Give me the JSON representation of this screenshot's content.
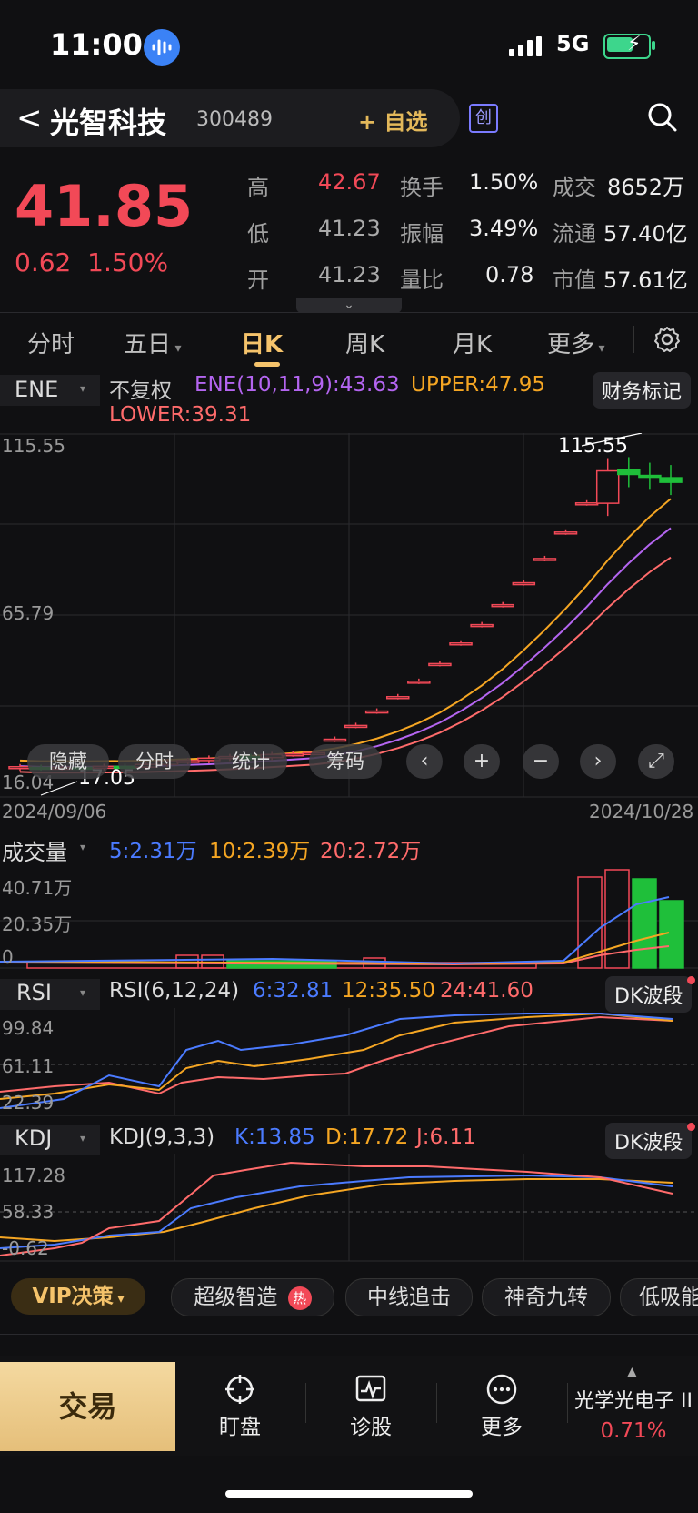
{
  "status": {
    "time": "11:00",
    "network": "5G"
  },
  "header": {
    "back": "<",
    "name": "光智科技",
    "code": "300489",
    "add_fav": "+ 自选",
    "board_badge": "创"
  },
  "quote": {
    "price": "41.85",
    "change": "0.62",
    "change_pct": "1.50%",
    "rows": [
      {
        "l1": "高",
        "v1": "42.67",
        "l2": "换手",
        "v2": "1.50%",
        "l3": "成交",
        "v3": "8652万"
      },
      {
        "l1": "低",
        "v1": "41.23",
        "l2": "振幅",
        "v2": "3.49%",
        "l3": "流通",
        "v3": "57.40亿"
      },
      {
        "l1": "开",
        "v1": "41.23",
        "l2": "量比",
        "v2": "0.78",
        "l3": "市值",
        "v3": "57.61亿"
      }
    ]
  },
  "tabs": [
    "分时",
    "五日",
    "日K",
    "周K",
    "月K",
    "更多"
  ],
  "active_tab": "日K",
  "main_chart": {
    "indicator": "ENE",
    "adjust": "不复权",
    "ene_label": "ENE(10,11,9):43.63",
    "upper_label": "UPPER:47.95",
    "lower_label": "LOWER:39.31",
    "finance_btn": "财务标记",
    "y_top": "115.55",
    "y_mid": "65.79",
    "y_bottom": "16.04",
    "max_marker": "115.55",
    "min_marker": "17.05",
    "date_start": "2024/09/06",
    "date_end": "2024/10/28",
    "overlay": {
      "hide": "隐藏",
      "intraday": "分时",
      "stats": "统计",
      "chips": "筹码"
    }
  },
  "volume": {
    "label": "成交量",
    "ma5": "5:2.31万",
    "ma10": "10:2.39万",
    "ma20": "20:2.72万",
    "y_top": "40.71万",
    "y_mid": "20.35万",
    "y_bottom": "0"
  },
  "rsi": {
    "label": "RSI",
    "params": "RSI(6,12,24)",
    "r6": "6:32.81",
    "r12": "12:35.50",
    "r24": "24:41.60",
    "btn": "DK波段",
    "y_top": "99.84",
    "y_mid": "61.11",
    "y_bottom": "22.39"
  },
  "kdj": {
    "label": "KDJ",
    "params": "KDJ(9,3,3)",
    "k": "K:13.85",
    "d": "D:17.72",
    "j": "J:6.11",
    "btn": "DK波段",
    "y_top": "117.28",
    "y_mid": "58.33",
    "y_bottom": "-0.62"
  },
  "vip": {
    "label": "VIP决策",
    "chips": [
      "超级智造",
      "中线追击",
      "神奇九转",
      "低吸能"
    ],
    "hot": "热"
  },
  "bottom_nav": {
    "trade": "交易",
    "watch": "盯盘",
    "diagnose": "诊股",
    "more": "更多",
    "sector": "光学光电子 II",
    "sector_pct": "0.71%"
  },
  "colors": {
    "up": "#f24957",
    "down": "#1fbf3a",
    "accent": "#f5c36b"
  },
  "chart_data": {
    "type": "candlestick",
    "x_range": [
      "2024/09/06",
      "2024/10/28"
    ],
    "ylim": [
      16.04,
      115.55
    ],
    "candles": [
      {
        "o": 17.05,
        "c": 17.5
      },
      {
        "o": 17.3,
        "c": 17.1
      },
      {
        "o": 17.2,
        "c": 17.3
      },
      {
        "o": 17.3,
        "c": 17.2
      },
      {
        "o": 17.2,
        "c": 17.6
      },
      {
        "o": 17.6,
        "c": 17.4
      },
      {
        "o": 17.4,
        "c": 18.2
      },
      {
        "o": 18.2,
        "c": 19.1
      },
      {
        "o": 19.1,
        "c": 19.4
      },
      {
        "o": 19.4,
        "c": 20.1
      },
      {
        "o": 20.1,
        "c": 20.6
      },
      {
        "o": 20.6,
        "c": 20.3
      },
      {
        "o": 20.3,
        "c": 21.2
      },
      {
        "o": 21.4,
        "c": 21.4
      },
      {
        "o": 21.8,
        "c": 21.8
      },
      {
        "o": 25.9,
        "c": 25.9
      },
      {
        "o": 30.1,
        "c": 30.1
      },
      {
        "o": 34.5,
        "c": 34.5
      },
      {
        "o": 38.9,
        "c": 38.9
      },
      {
        "o": 43.6,
        "c": 43.6
      },
      {
        "o": 49.0,
        "c": 49.0
      },
      {
        "o": 55.3,
        "c": 55.3
      },
      {
        "o": 60.9,
        "c": 60.9
      },
      {
        "o": 67.0,
        "c": 67.0
      },
      {
        "o": 73.7,
        "c": 73.7
      },
      {
        "o": 81.1,
        "c": 81.1
      },
      {
        "o": 89.2,
        "c": 89.2
      },
      {
        "o": 98.1,
        "c": 98.1
      },
      {
        "o": 98.0,
        "c": 107.9
      },
      {
        "o": 108.2,
        "c": 106.8
      },
      {
        "o": 106.5,
        "c": 106.0
      },
      {
        "o": 105.8,
        "c": 104.4
      }
    ]
  }
}
